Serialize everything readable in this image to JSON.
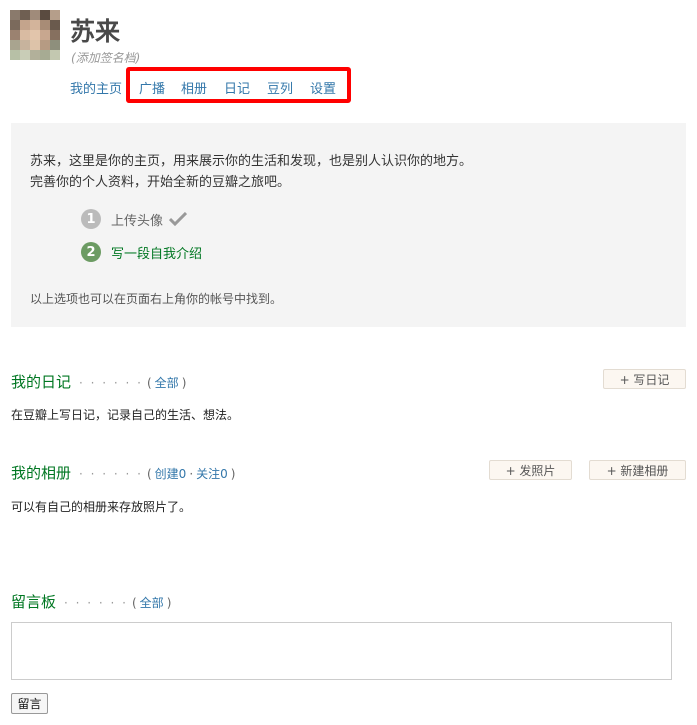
{
  "profile": {
    "name": "苏来",
    "signature": "(添加签名档)"
  },
  "nav": {
    "items": [
      {
        "label": "我的主页"
      },
      {
        "label": "广播"
      },
      {
        "label": "相册"
      },
      {
        "label": "日记"
      },
      {
        "label": "豆列"
      },
      {
        "label": "设置"
      }
    ]
  },
  "intro": {
    "line1": "苏来，这里是你的主页，用来展示你的生活和发现，也是别人认识你的地方。",
    "line2": "完善你的个人资料，开始全新的豆瓣之旅吧。",
    "steps": [
      {
        "num": "1",
        "label": "上传头像",
        "done": true
      },
      {
        "num": "2",
        "label": "写一段自我介绍",
        "done": false
      }
    ],
    "footer": "以上选项也可以在页面右上角你的帐号中找到。"
  },
  "diary": {
    "title": "我的日记",
    "dots": "· · · · · ·",
    "meta_open": "(",
    "all": "全部",
    "meta_close": ")",
    "button": "+ 写日记",
    "desc": "在豆瓣上写日记，记录自己的生活、想法。"
  },
  "album": {
    "title": "我的相册",
    "dots": "· · · · · ·",
    "meta_open": "(",
    "created": "创建0",
    "sep": "·",
    "followed": "关注0",
    "meta_close": ")",
    "upload_button": "+ 发照片",
    "new_button": "+ 新建相册",
    "desc": "可以有自己的相册来存放照片了。"
  },
  "guestbook": {
    "title": "留言板",
    "dots": "· · · · · ·",
    "meta_open": "(",
    "all": "全部",
    "meta_close": ")",
    "submit": "留言"
  },
  "colors": {
    "link": "#3377aa",
    "green": "#007722",
    "highlight": "#ff0000"
  }
}
